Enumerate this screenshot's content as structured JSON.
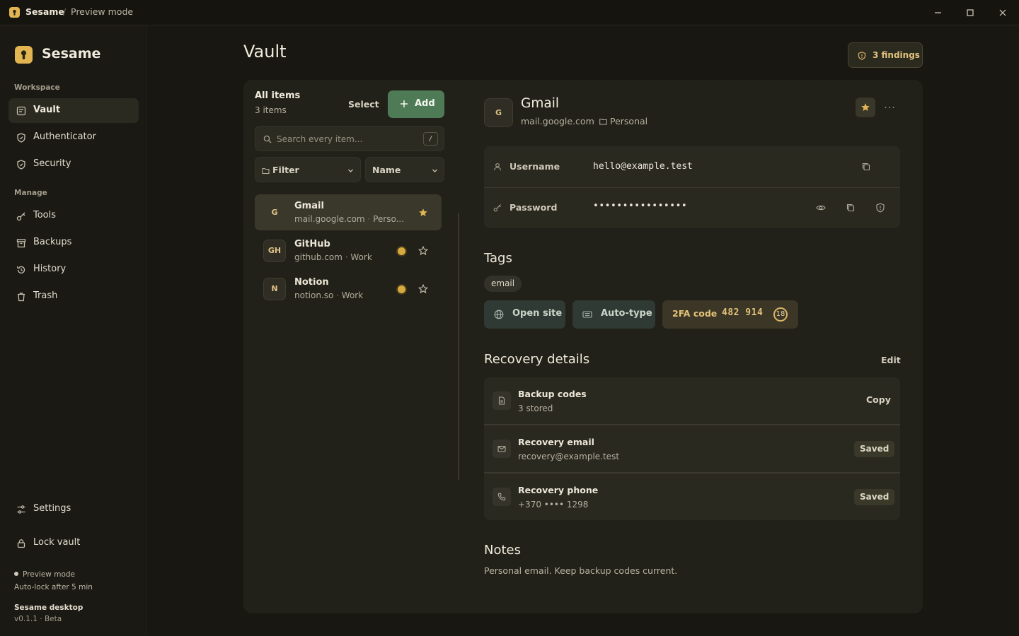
{
  "titlebar": {
    "app_name": "Sesame",
    "separator": "/",
    "mode": "Preview mode"
  },
  "sidebar": {
    "brand": "Sesame",
    "sections": {
      "workspace": "Workspace",
      "manage": "Manage"
    },
    "items": [
      {
        "label": "Vault",
        "icon": "vault-icon",
        "active": true
      },
      {
        "label": "Authenticator",
        "icon": "shield-icon"
      },
      {
        "label": "Security",
        "icon": "shield-check-icon"
      },
      {
        "label": "Tools",
        "icon": "key-icon"
      },
      {
        "label": "Backups",
        "icon": "archive-icon"
      },
      {
        "label": "History",
        "icon": "history-icon"
      },
      {
        "label": "Trash",
        "icon": "trash-icon"
      }
    ],
    "settings_label": "Settings",
    "lock_label": "Lock vault",
    "status": "Preview mode",
    "autolock": "Auto-lock after 5 min",
    "app_title": "Sesame desktop",
    "version": "v0.1.1 · Beta"
  },
  "main": {
    "title": "Vault",
    "findings_label": "3 findings"
  },
  "list": {
    "title": "All items",
    "count": "3 items",
    "select_label": "Select",
    "add_label": "Add",
    "search_placeholder": "Search every item...",
    "search_shortcut": "/",
    "filter_label": "Filter",
    "sort_label": "Name",
    "items": [
      {
        "initials": "G",
        "name": "Gmail",
        "domain": "mail.google.com",
        "folder": "Perso...",
        "favorite": true,
        "warning": false,
        "active": true
      },
      {
        "initials": "GH",
        "name": "GitHub",
        "domain": "github.com",
        "folder": "Work",
        "favorite": false,
        "warning": true
      },
      {
        "initials": "N",
        "name": "Notion",
        "domain": "notion.so",
        "folder": "Work",
        "favorite": false,
        "warning": true
      }
    ]
  },
  "detail": {
    "initials": "G",
    "title": "Gmail",
    "domain": "mail.google.com",
    "dot": "·",
    "folder": "Personal",
    "fields": {
      "username_label": "Username",
      "username_value": "hello@example.test",
      "password_label": "Password",
      "password_value": "••••••••••••••••"
    },
    "tags_heading": "Tags",
    "tags": [
      "email"
    ],
    "open_site_label": "Open site",
    "autotype_label": "Auto-type",
    "twofa_label": "2FA code",
    "twofa_code": "482 914",
    "twofa_seconds": "18",
    "recovery_heading": "Recovery details",
    "edit_label": "Edit",
    "recovery": [
      {
        "title": "Backup codes",
        "subtitle": "3 stored",
        "action": "Copy"
      },
      {
        "title": "Recovery email",
        "subtitle": "recovery@example.test",
        "badge": "Saved"
      },
      {
        "title": "Recovery phone",
        "subtitle": "+370 •••• 1298",
        "badge": "Saved"
      }
    ],
    "notes_heading": "Notes",
    "notes_text": "Personal email. Keep backup codes current."
  },
  "colors": {
    "accent_green": "#4e7a55",
    "accent_gold": "#d9b364",
    "background": "#181711",
    "panel": "#222119"
  }
}
